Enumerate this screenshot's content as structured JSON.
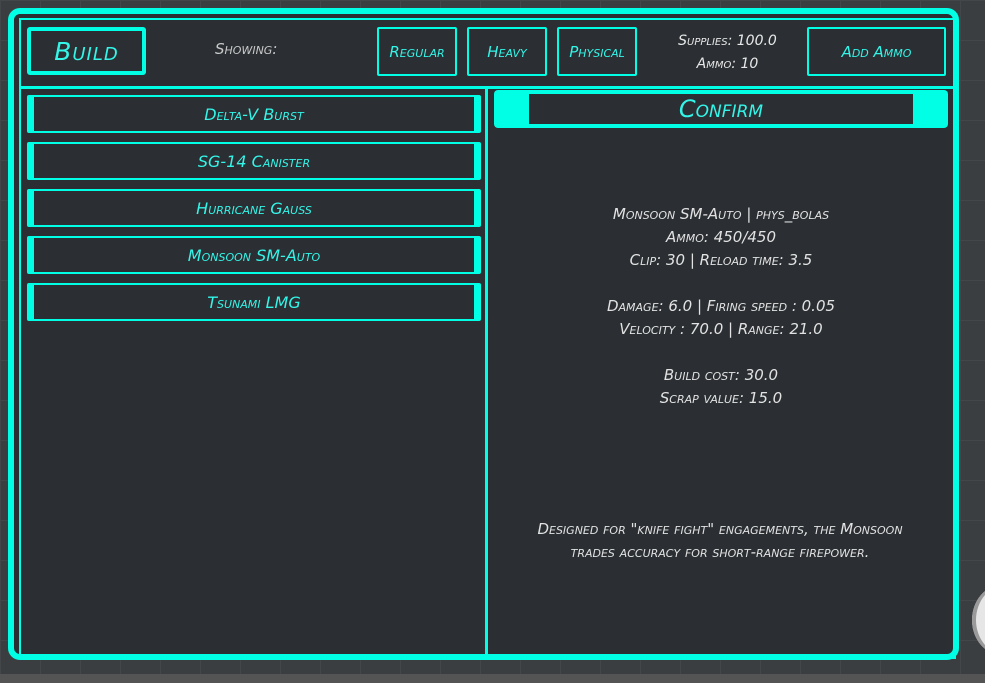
{
  "header": {
    "build_label": "Build",
    "showing_label": "Showing:",
    "filters": [
      "Regular",
      "Heavy",
      "Physical"
    ],
    "supplies": "Supplies: 100.0",
    "ammo": "Ammo: 10",
    "add_ammo_label": "Add Ammo"
  },
  "weapons": [
    "Delta-V Burst",
    "SG-14 Canister",
    "Hurricane Gauss",
    "Monsoon SM-Auto",
    "Tsunami LMG"
  ],
  "confirm_label": "Confirm",
  "details": {
    "name_line": "Monsoon SM-Auto | phys_bolas",
    "ammo_line": "Ammo: 450/450",
    "clip_line": "Clip: 30 | Reload time: 3.5",
    "damage_line": "Damage: 6.0 | Firing speed : 0.05",
    "velocity_line": "Velocity : 70.0 | Range: 21.0",
    "cost_line": "Build cost: 30.0",
    "scrap_line": "Scrap value: 15.0",
    "description": "Designed for \"knife fight\" engagements, the Monsoon trades accuracy for short-range firepower."
  }
}
